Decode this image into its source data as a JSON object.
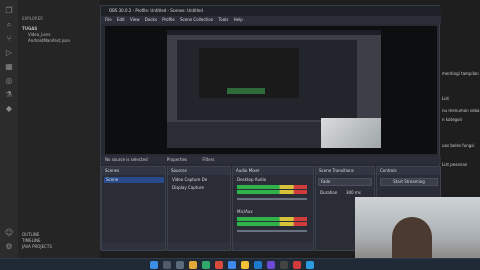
{
  "explorer": {
    "header": "EXPLORER",
    "folder": "TUGAS",
    "files": [
      "Video_Lens",
      "AndroidManifest.json"
    ],
    "outline": "OUTLINE",
    "timeline": "TIMELINE",
    "java_projects": "JAVA PROJECTS"
  },
  "vscode_right": {
    "lines": [
      "mentingi tampilan",
      "List",
      "nu menuman seba",
      "n kategori",
      "uas beles fungsi",
      "List pesenan"
    ]
  },
  "obs": {
    "title": "OBS 30.0.2 - Profile: Untitled - Scenes: Untitled",
    "menu": [
      "File",
      "Edit",
      "View",
      "Docks",
      "Profile",
      "Scene Collection",
      "Tools",
      "Help"
    ],
    "info_bar": "No source is selected",
    "properties_label": "Properties",
    "filters_label": "Filters",
    "docks": {
      "scenes": {
        "title": "Scenes",
        "items": [
          "Scene"
        ]
      },
      "sources": {
        "title": "Sources",
        "items": [
          "Video Capture De",
          "Display Capture"
        ]
      },
      "mixer": {
        "title": "Audio Mixer",
        "channels": [
          "Desktop Audio",
          "Mic/Aux"
        ]
      },
      "transitions": {
        "title": "Scene Transitions",
        "type": "Fade",
        "duration_label": "Duration",
        "duration": "300 ms"
      },
      "controls": {
        "title": "Controls",
        "start_streaming": "Start Streaming"
      }
    }
  },
  "icons": [
    "files-icon",
    "search-icon",
    "source-control-icon",
    "run-debug-icon",
    "extensions-icon",
    "account-icon",
    "settings-icon"
  ]
}
